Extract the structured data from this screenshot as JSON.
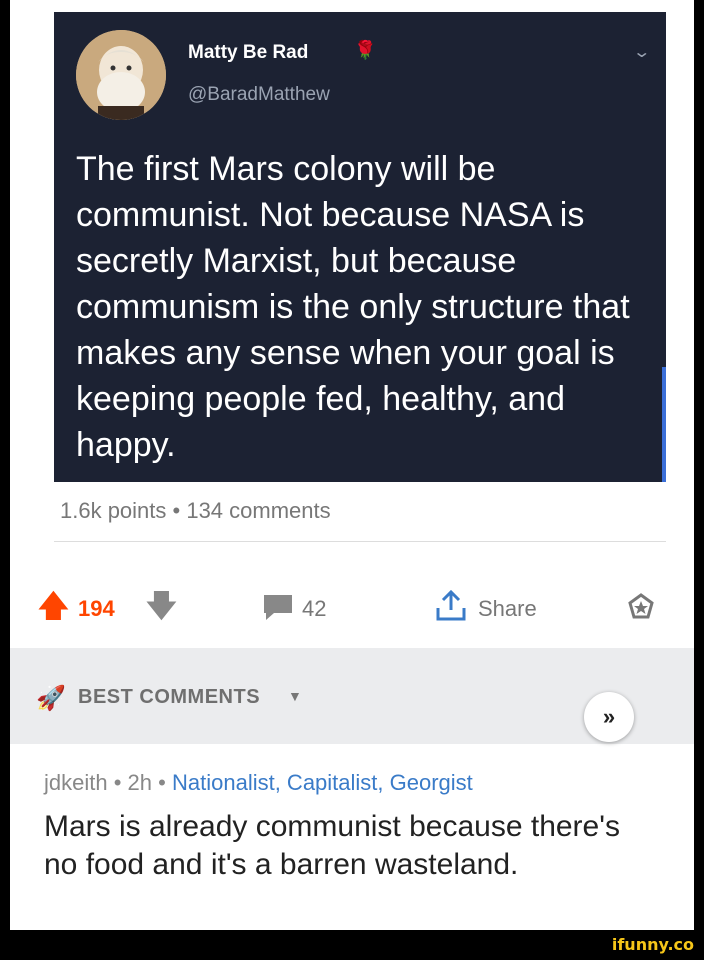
{
  "tweet": {
    "name": "Matty Be Rad",
    "handle": "@BaradMatthew",
    "text": "The first Mars colony will be communist. Not because NASA is secretly Marxist, but because communism is the only structure that makes any sense when your goal is keeping people fed, healthy, and happy.",
    "avatar_icon": "marx-portrait-avatar",
    "name_icon": "rose-icon",
    "menu_icon": "chevron-down-icon"
  },
  "post": {
    "stats": "1.6k points • 134 comments"
  },
  "actions": {
    "upvotes": "194",
    "comments": "42",
    "share_label": "Share",
    "accent": "#ff4500"
  },
  "best_comments": {
    "label": "BEST COMMENTS"
  },
  "comment": {
    "author": "jdkeith",
    "age": "2h",
    "flair": "Nationalist, Capitalist, Georgist",
    "body": "Mars is already communist because there's no food and it's a barren wasteland."
  },
  "watermark": "ifunny.co"
}
